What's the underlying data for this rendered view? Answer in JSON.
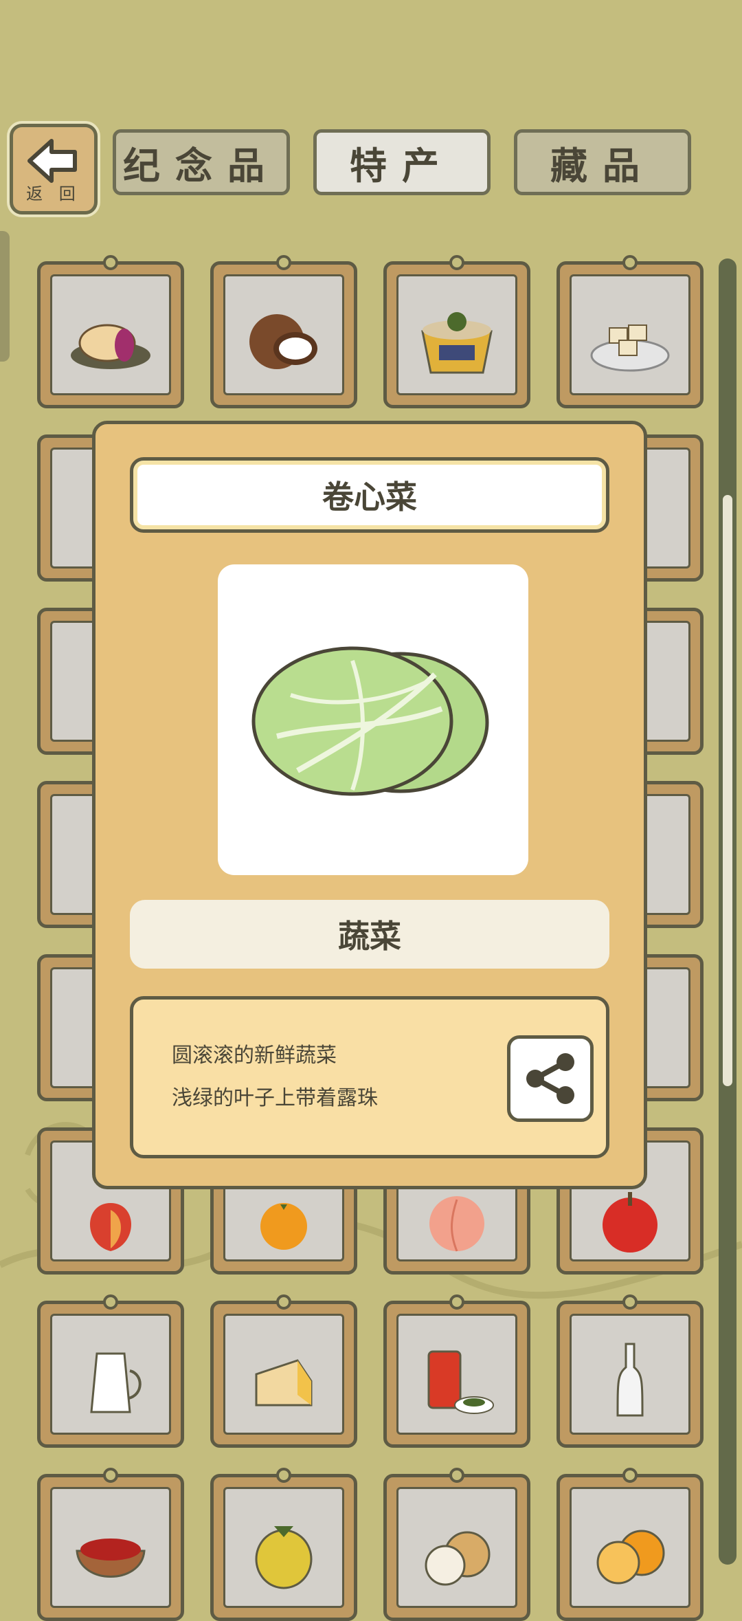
{
  "header": {
    "back_label": "返 回",
    "tabs": [
      {
        "label": "纪念品",
        "active": false
      },
      {
        "label": "特产",
        "active": true
      },
      {
        "label": "藏品",
        "active": false
      }
    ]
  },
  "grid": {
    "items": [
      {
        "icon": "mooncake-icon"
      },
      {
        "icon": "coconut-icon"
      },
      {
        "icon": "noodle-cup-icon"
      },
      {
        "icon": "tofu-plate-icon"
      },
      {
        "icon": "peach-icon"
      },
      {
        "icon": "orange-icon"
      },
      {
        "icon": "peach-icon"
      },
      {
        "icon": "apple-icon"
      },
      {
        "icon": "milk-jug-icon"
      },
      {
        "icon": "cheese-icon"
      },
      {
        "icon": "tea-can-icon"
      },
      {
        "icon": "bottle-icon"
      },
      {
        "icon": "dried-fruit-bowl-icon"
      },
      {
        "icon": "kiwano-icon"
      },
      {
        "icon": "longan-icon"
      },
      {
        "icon": "orange-slice-icon"
      }
    ]
  },
  "popup": {
    "title": "卷心菜",
    "image_icon": "cabbage-icon",
    "category": "蔬菜",
    "description": [
      "圆滚滚的新鲜蔬菜",
      "浅绿的叶子上带着露珠"
    ],
    "share_icon": "share-icon"
  },
  "colors": {
    "background": "#c4bd7e",
    "popup": "#e7c27e",
    "outline": "#5e5b44"
  }
}
